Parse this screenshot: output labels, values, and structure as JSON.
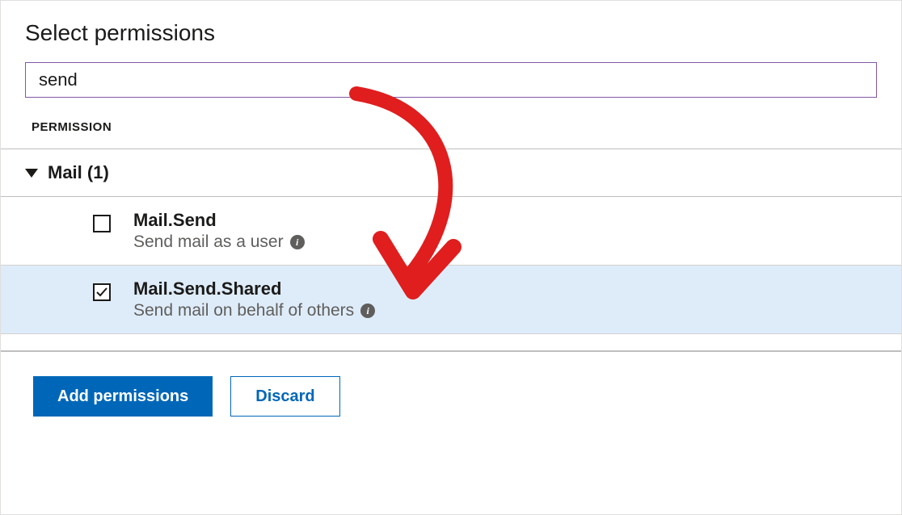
{
  "title": "Select permissions",
  "search": {
    "value": "send"
  },
  "columns": {
    "permission": "PERMISSION"
  },
  "group": {
    "label": "Mail (1)"
  },
  "permissions": [
    {
      "name": "Mail.Send",
      "desc": "Send mail as a user",
      "checked": false,
      "selected": false
    },
    {
      "name": "Mail.Send.Shared",
      "desc": "Send mail on behalf of others",
      "checked": true,
      "selected": true
    }
  ],
  "buttons": {
    "add": "Add permissions",
    "discard": "Discard"
  },
  "annotation": {
    "color": "#e01e1e"
  }
}
